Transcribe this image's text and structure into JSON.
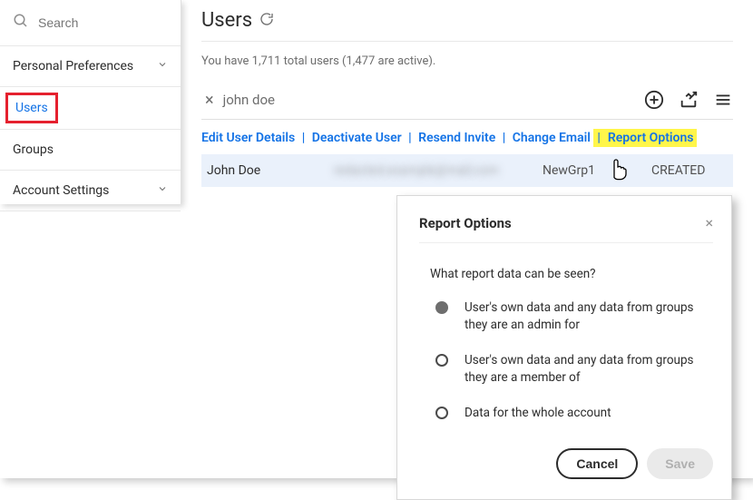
{
  "sidebar": {
    "search_placeholder": "Search",
    "items": [
      {
        "label": "Personal Preferences",
        "expandable": true,
        "active": false
      },
      {
        "label": "Users",
        "expandable": false,
        "active": true
      },
      {
        "label": "Groups",
        "expandable": false,
        "active": false
      },
      {
        "label": "Account Settings",
        "expandable": true,
        "active": false
      }
    ]
  },
  "header": {
    "title": "Users",
    "subtext": "You have 1,711 total users (1,477 are active)."
  },
  "filter": {
    "clear": "×",
    "term": "john doe"
  },
  "actions": {
    "edit": "Edit User Details",
    "deactivate": "Deactivate User",
    "resend": "Resend Invite",
    "change_email": "Change Email",
    "report_options": "Report Options",
    "sep": "|"
  },
  "table": {
    "rows": [
      {
        "name": "John Doe",
        "email": "redacted.example@mail.com",
        "group": "NewGrp1",
        "status": "CREATED"
      }
    ]
  },
  "modal": {
    "title": "Report Options",
    "close": "×",
    "question": "What report data can be seen?",
    "options": [
      {
        "label": "User's own data and any data from groups they are an admin for",
        "selected": true
      },
      {
        "label": "User's own data and any data from groups they are a member of",
        "selected": false
      },
      {
        "label": "Data for the whole account",
        "selected": false
      }
    ],
    "cancel": "Cancel",
    "save": "Save"
  }
}
